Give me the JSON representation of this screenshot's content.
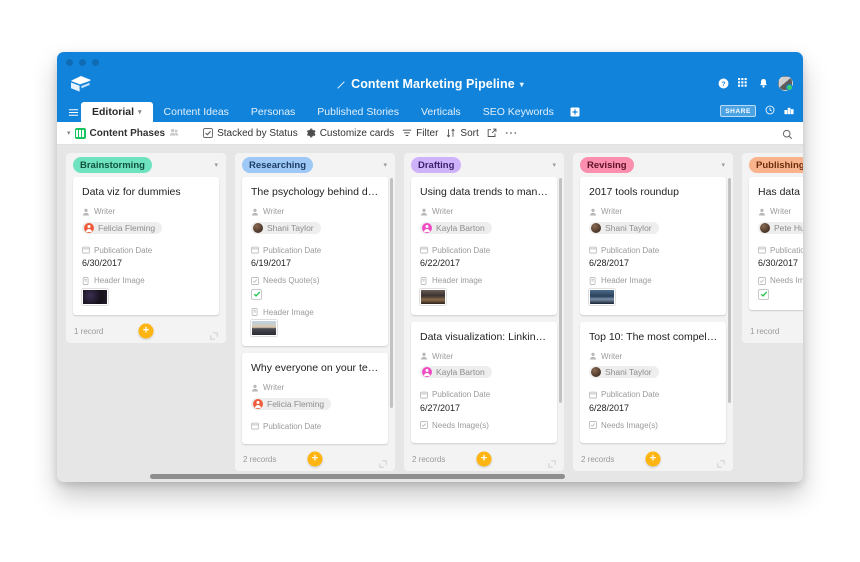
{
  "window": {
    "traffic_lights": [
      "close",
      "minimize",
      "zoom"
    ],
    "logo_icon": "airtable-logo-icon"
  },
  "header": {
    "title": "Content Marketing Pipeline",
    "edit_icon": "pencil-icon",
    "title_caret": "▾",
    "icons": [
      "help-icon",
      "apps-grid-icon",
      "bell-icon",
      "user-avatar"
    ],
    "share_label": "SHARE",
    "right_icons": [
      "history-icon",
      "apps-icon"
    ]
  },
  "tabs": {
    "menu_icon": "hamburger-icon",
    "add_icon": "add-table-icon",
    "items": [
      {
        "label": "Editorial",
        "active": true,
        "caret": "▾"
      },
      {
        "label": "Content Ideas",
        "active": false
      },
      {
        "label": "Personas",
        "active": false
      },
      {
        "label": "Published Stories",
        "active": false
      },
      {
        "label": "Verticals",
        "active": false
      },
      {
        "label": "SEO Keywords",
        "active": false
      }
    ]
  },
  "toolbar": {
    "view_caret": "▾",
    "view_name": "Content Phases",
    "view_color": "#16c45f",
    "collaborators_icon": "collaborators-icon",
    "items": [
      {
        "label": "Stacked by Status",
        "icon": "stack-icon"
      },
      {
        "label": "Customize cards",
        "icon": "gear-icon"
      },
      {
        "label": "Filter",
        "icon": "filter-icon"
      },
      {
        "label": "Sort",
        "icon": "sort-icon"
      }
    ],
    "share_view_icon": "share-view-icon",
    "more_icon": "more-icon",
    "search_icon": "search-icon"
  },
  "board": {
    "add_symbol": "+",
    "expand_icon": "expand-icon",
    "stacks": [
      {
        "name": "Brainstorming",
        "pill_bg": "#6fe3bf",
        "pill_fg": "#10503c",
        "record_count": "1 record",
        "cards": [
          {
            "title": "Data viz for dummies",
            "writer_label": "Writer",
            "writer": "Felicia Fleming",
            "writer_color": "#f05a3c",
            "date_label": "Publication Date",
            "date": "6/30/2017",
            "image_label": "Header Image",
            "thumb": "dark-abstract"
          }
        ]
      },
      {
        "name": "Researching",
        "pill_bg": "#9ec9f7",
        "pill_fg": "#1e3c63",
        "record_count": "2 records",
        "cards": [
          {
            "title": "The psychology behind d…",
            "writer_label": "Writer",
            "writer": "Shani Taylor",
            "writer_color": "#5a4034",
            "date_label": "Publication Date",
            "date": "6/19/2017",
            "check_label": "Needs Quote(s)",
            "checked": true,
            "image_label": "Header Image",
            "thumb": "city-sunset"
          },
          {
            "title": "Why everyone on your te…",
            "writer_label": "Writer",
            "writer": "Felicia Fleming",
            "writer_color": "#f05a3c",
            "date_label": "Publication Date"
          }
        ]
      },
      {
        "name": "Drafting",
        "pill_bg": "#cfb3fa",
        "pill_fg": "#3a1f6b",
        "record_count": "2 records",
        "cards": [
          {
            "title": "Using data trends to man…",
            "writer_label": "Writer",
            "writer": "Kayla Barton",
            "writer_color": "#ee4bc4",
            "date_label": "Publication Date",
            "date": "6/22/2017",
            "image_label": "Header image",
            "thumb": "crowd-photo"
          },
          {
            "title": "Data visualization: Linkin…",
            "writer_label": "Writer",
            "writer": "Kayla Barton",
            "writer_color": "#ee4bc4",
            "date_label": "Publication Date",
            "date": "6/27/2017",
            "check_label": "Needs Image(s)"
          }
        ]
      },
      {
        "name": "Revising",
        "pill_bg": "#fc8fae",
        "pill_fg": "#5e1028",
        "record_count": "2 records",
        "cards": [
          {
            "title": "2017 tools roundup",
            "writer_label": "Writer",
            "writer": "Shani Taylor",
            "writer_color": "#5a4034",
            "date_label": "Publication Date",
            "date": "6/28/2017",
            "image_label": "Header Image",
            "thumb": "night-city"
          },
          {
            "title": "Top 10: The most compel…",
            "writer_label": "Writer",
            "writer": "Shani Taylor",
            "writer_color": "#5a4034",
            "date_label": "Publication Date",
            "date": "6/28/2017",
            "check_label": "Needs Image(s)"
          }
        ]
      },
      {
        "name": "Publishing",
        "pill_bg": "#f9b38c",
        "pill_fg": "#6b2e0e",
        "record_count": "1 record",
        "cards": [
          {
            "title": "Has data v",
            "writer_label": "Writer",
            "writer": "Pete Huan",
            "writer_color": "#5a4034",
            "date_label": "Publication",
            "date": "6/30/2017",
            "check_label": "Needs Ima",
            "checked": true
          }
        ]
      }
    ]
  }
}
